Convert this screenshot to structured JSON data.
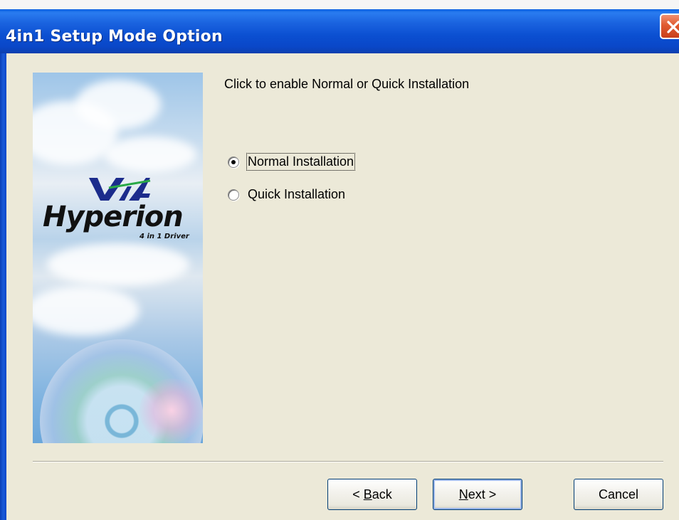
{
  "window": {
    "title": "4in1 Setup Mode Option"
  },
  "banner": {
    "brand": "Hyperion",
    "brand_sub": "4 in 1 Driver",
    "logo": "via-logo"
  },
  "content": {
    "prompt": "Click to enable Normal or Quick Installation",
    "options": [
      {
        "label": "Normal Installation",
        "selected": true
      },
      {
        "label": "Quick Installation",
        "selected": false
      }
    ]
  },
  "buttons": {
    "back": {
      "prefix": "< ",
      "accel": "B",
      "rest": "ack"
    },
    "next": {
      "accel": "N",
      "rest": "ext >"
    },
    "cancel": "Cancel"
  },
  "colors": {
    "titlebar": "#0a47c8",
    "close": "#e05a30",
    "dialog_bg": "#ece9d8"
  }
}
